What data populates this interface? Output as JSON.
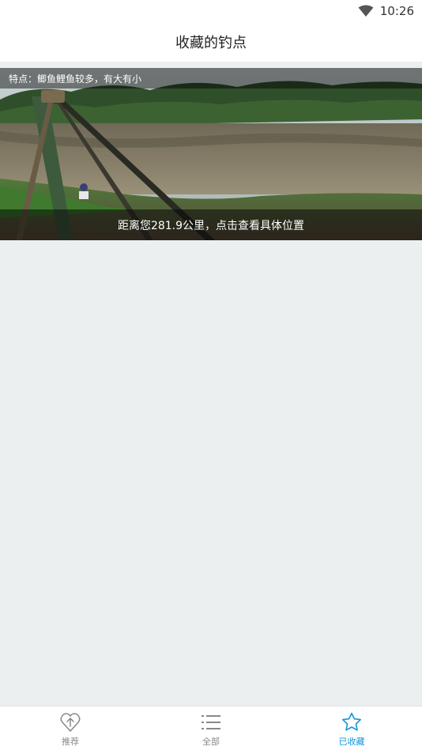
{
  "status_bar": {
    "time": "10:26",
    "wifi_icon": "wifi-icon"
  },
  "header": {
    "title": "收藏的钓点"
  },
  "spots": [
    {
      "feature_text": "特点：鲫鱼鲤鱼较多，有大有小",
      "distance_text": "距离您281.9公里，点击查看具体位置"
    }
  ],
  "bottom_nav": {
    "items": [
      {
        "label": "推荐",
        "icon": "heart-arrow-icon",
        "active": false
      },
      {
        "label": "全部",
        "icon": "list-icon",
        "active": false
      },
      {
        "label": "已收藏",
        "icon": "star-icon",
        "active": true
      }
    ]
  },
  "colors": {
    "accent": "#1296db",
    "inactive": "#888888",
    "background": "#ebeff0"
  }
}
